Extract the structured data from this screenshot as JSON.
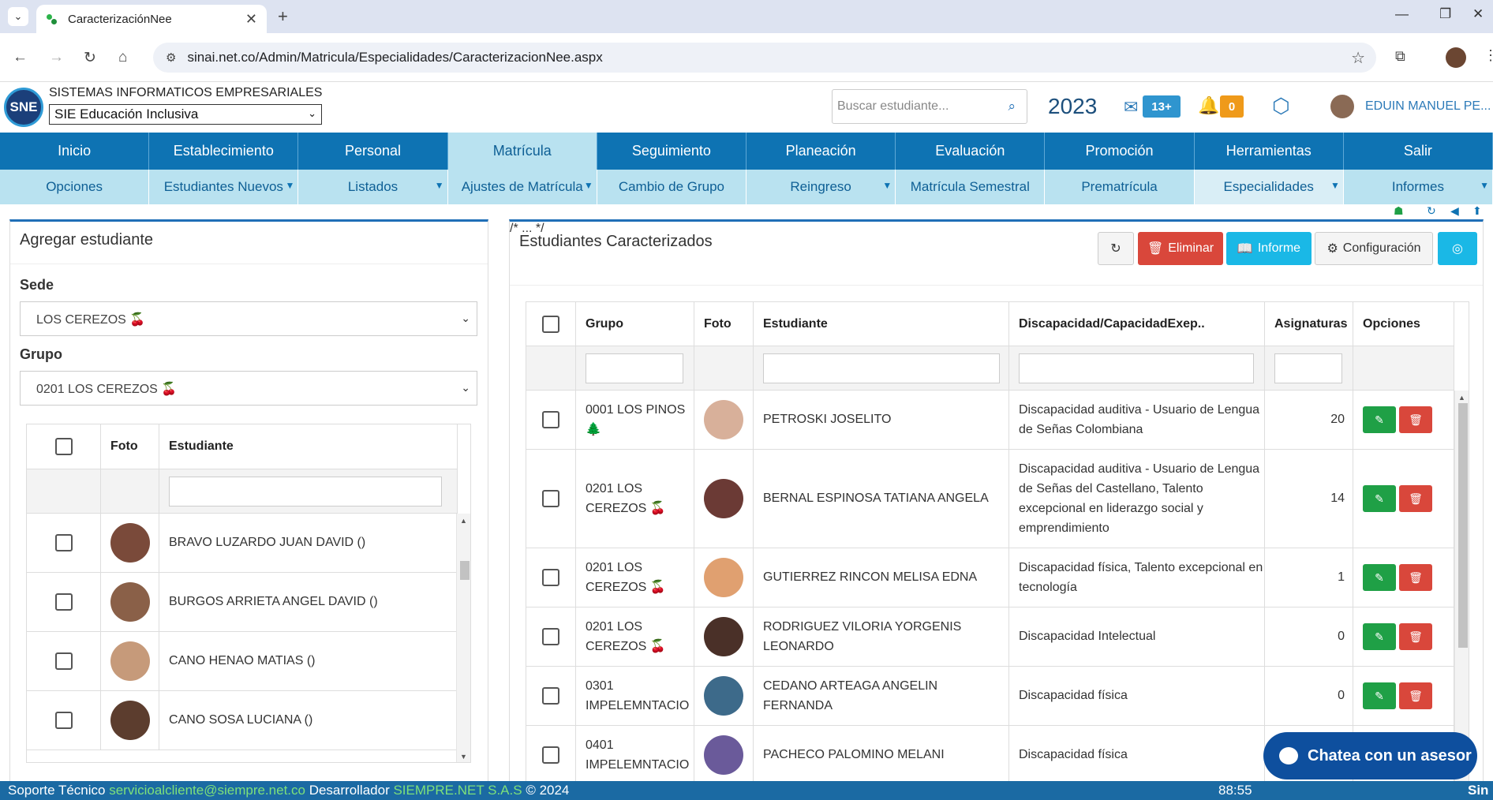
{
  "browser": {
    "tab_title": "CaracterizaciónNee",
    "url": "sinai.net.co/Admin/Matricula/Especialidades/CaracterizacionNee.aspx"
  },
  "header": {
    "company": "SISTEMAS INFORMATICOS EMPRESARIALES",
    "logo_text": "SNE",
    "module": "SIE Educación Inclusiva",
    "search_placeholder": "Buscar estudiante...",
    "year": "2023",
    "mail_badge": "13+",
    "bell_badge": "0",
    "user_name": "EDUIN MANUEL PE..."
  },
  "main_menu": [
    "Inicio",
    "Establecimiento",
    "Personal",
    "Matrícula",
    "Seguimiento",
    "Planeación",
    "Evaluación",
    "Promoción",
    "Herramientas",
    "Salir"
  ],
  "sub_menu": [
    {
      "label": "Opciones",
      "dd": false
    },
    {
      "label": "Estudiantes Nuevos",
      "dd": true
    },
    {
      "label": "Listados",
      "dd": true
    },
    {
      "label": "Ajustes de Matrícula",
      "dd": true
    },
    {
      "label": "Cambio de Grupo",
      "dd": false
    },
    {
      "label": "Reingreso",
      "dd": true
    },
    {
      "label": "Matrícula Semestral",
      "dd": false
    },
    {
      "label": "Prematrícula",
      "dd": false
    },
    {
      "label": "Especialidades",
      "dd": true
    },
    {
      "label": "Informes",
      "dd": true
    }
  ],
  "left_panel": {
    "title": "Agregar estudiante",
    "sede_label": "Sede",
    "sede_value": "LOS CEREZOS 🍒",
    "grupo_label": "Grupo",
    "grupo_value": "0201 LOS CEREZOS 🍒",
    "columns": [
      "Foto",
      "Estudiante"
    ],
    "students": [
      {
        "name": "BRAVO LUZARDO JUAN DAVID ()",
        "color": "#7a4a3a"
      },
      {
        "name": "BURGOS ARRIETA ANGEL DAVID ()",
        "color": "#8a6048"
      },
      {
        "name": "CANO HENAO MATIAS ()",
        "color": "#c69a7a"
      },
      {
        "name": "CANO SOSA LUCIANA ()",
        "color": "#5c3d2e"
      }
    ]
  },
  "right_panel": {
    "title": "Estudiantes Caracterizados",
    "buttons": {
      "eliminar": "Eliminar",
      "informe": "Informe",
      "configuracion": "Configuración"
    },
    "columns": [
      "Grupo",
      "Foto",
      "Estudiante",
      "Discapacidad/CapacidadExep..",
      "Asignaturas",
      "Opciones"
    ],
    "rows": [
      {
        "grupo": "0001 LOS PINOS 🌲",
        "estudiante": "PETROSKI JOSELITO",
        "discapacidad": "Discapacidad auditiva - Usuario de Lengua de Señas Colombiana",
        "asignaturas": "20",
        "color": "#d8b09a",
        "opts": true
      },
      {
        "grupo": "0201 LOS CEREZOS 🍒",
        "estudiante": "BERNAL ESPINOSA TATIANA ANGELA",
        "discapacidad": "Discapacidad auditiva - Usuario de Lengua de Señas del Castellano, Talento excepcional en liderazgo social y emprendimiento",
        "asignaturas": "14",
        "color": "#6b3a35",
        "opts": true
      },
      {
        "grupo": "0201 LOS CEREZOS 🍒",
        "estudiante": "GUTIERREZ RINCON MELISA EDNA",
        "discapacidad": "Discapacidad física, Talento excepcional en tecnología",
        "asignaturas": "1",
        "color": "#e0a070",
        "opts": true
      },
      {
        "grupo": "0201 LOS CEREZOS 🍒",
        "estudiante": "RODRIGUEZ VILORIA YORGENIS LEONARDO",
        "discapacidad": "Discapacidad Intelectual",
        "asignaturas": "0",
        "color": "#4a3028",
        "opts": true
      },
      {
        "grupo": "0301 IMPELEMNTACIO",
        "estudiante": "CEDANO ARTEAGA ANGELIN FERNANDA",
        "discapacidad": "Discapacidad física",
        "asignaturas": "0",
        "color": "#3d6a8a",
        "opts": true
      },
      {
        "grupo": "0401 IMPELEMNTACIO",
        "estudiante": "PACHECO PALOMINO MELANI",
        "discapacidad": "Discapacidad física",
        "asignaturas": "",
        "color": "#6a5a9a",
        "opts": false
      }
    ]
  },
  "footer": {
    "support_label": "Soporte Técnico ",
    "support_email": "servicioalcliente@siempre.net.co",
    "dev_label": " Desarrollador ",
    "dev_name": "SIEMPRE.NET S.A.S",
    "copyright": " © 2024",
    "timer": "88:55",
    "brand": "Sin"
  },
  "chat": {
    "label": "Chatea con un asesor"
  }
}
